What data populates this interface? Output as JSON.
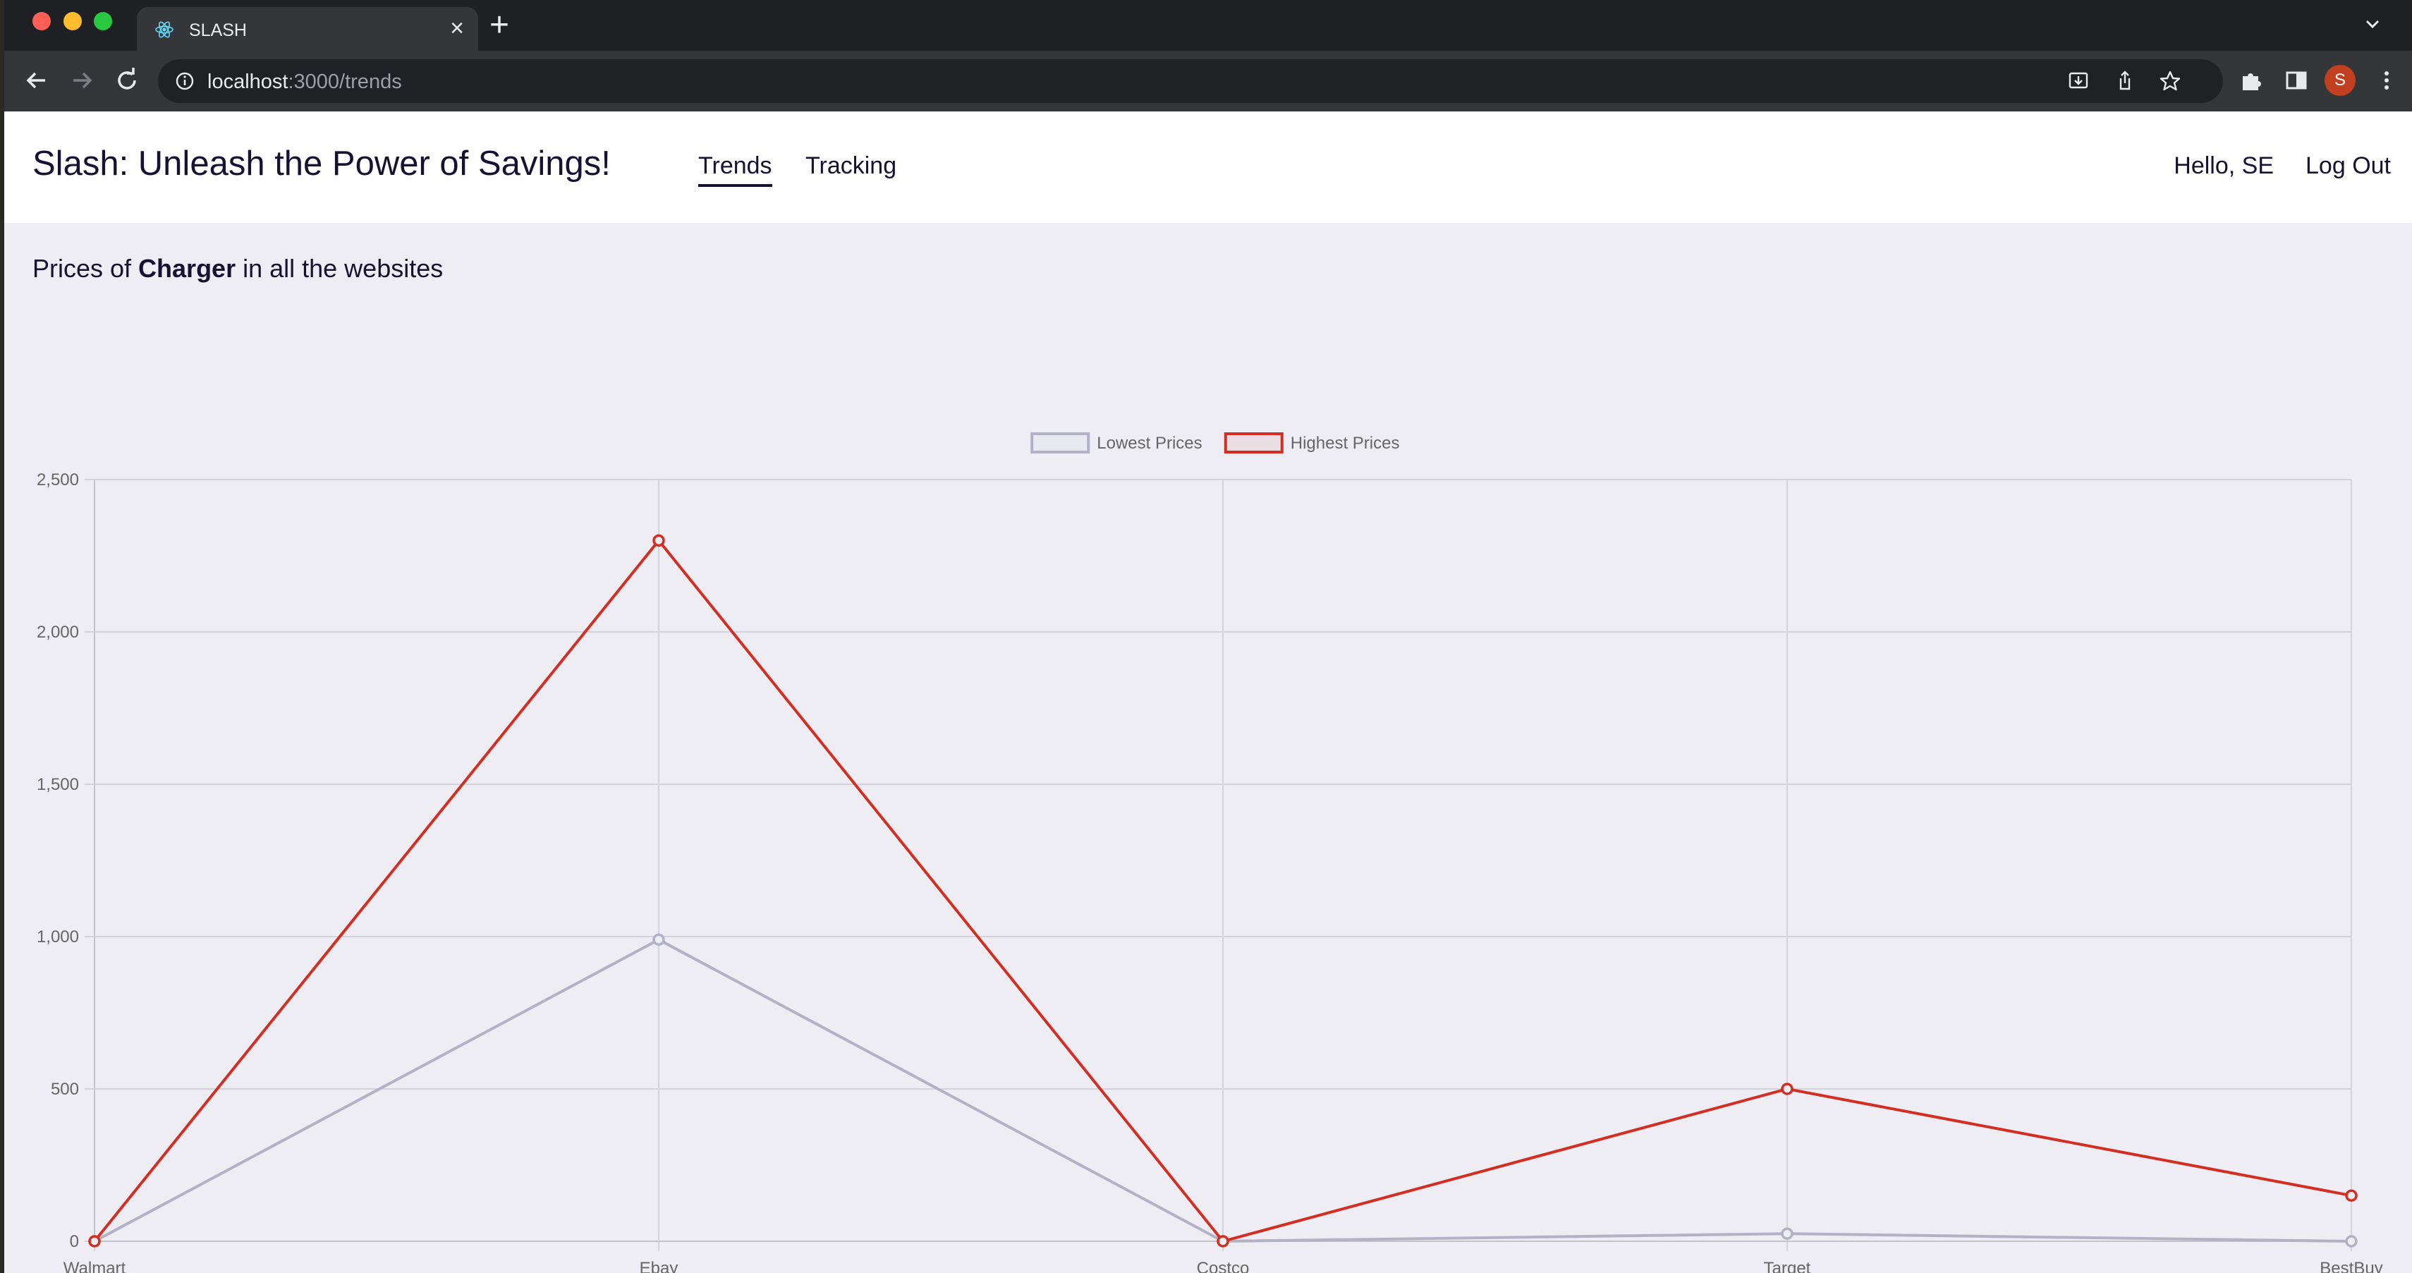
{
  "browser": {
    "tab_title": "SLASH",
    "url_host": "localhost",
    "url_path": ":3000/trends",
    "profile_initial": "S"
  },
  "app": {
    "brand": "Slash: Unleash the Power of Savings!",
    "nav": {
      "trends": "Trends",
      "tracking": "Tracking"
    },
    "greeting": "Hello, SE",
    "logout": "Log Out"
  },
  "heading": {
    "prefix": "Prices of ",
    "product": "Charger",
    "suffix": " in all the websites"
  },
  "colors": {
    "lowest": "#b3b1c6",
    "highest": "#d42e22",
    "grid": "#d4d3dd"
  },
  "chart_data": {
    "type": "line",
    "categories": [
      "Walmart",
      "Ebay",
      "Costco",
      "Target",
      "BestBuy"
    ],
    "series": [
      {
        "name": "Lowest Prices",
        "values": [
          0,
          990,
          0,
          25,
          0
        ]
      },
      {
        "name": "Highest Prices",
        "values": [
          0,
          2300,
          0,
          500,
          150
        ]
      }
    ],
    "ylim": [
      0,
      2500
    ],
    "yticks": [
      0,
      500,
      1000,
      1500,
      2000,
      2500
    ],
    "ytick_labels": [
      "0",
      "500",
      "1,000",
      "1,500",
      "2,000",
      "2,500"
    ],
    "grid": true,
    "legend_position": "top-center",
    "title": "",
    "xlabel": "",
    "ylabel": ""
  }
}
